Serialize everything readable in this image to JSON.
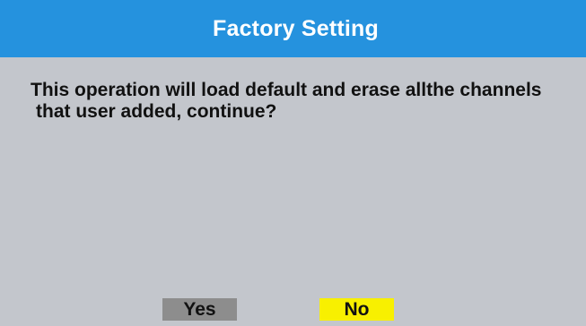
{
  "dialog": {
    "title": "Factory Setting",
    "message_line1": "This operation will load default and erase allthe channels",
    "message_line2": "that user added, continue?",
    "buttons": {
      "yes_label": "Yes",
      "no_label": "No",
      "selected": "No"
    }
  },
  "colors": {
    "title_bar": "#2592de",
    "background": "#c3c6cc",
    "yes_button": "#8d8d8d",
    "no_button_selected": "#f8f000"
  }
}
